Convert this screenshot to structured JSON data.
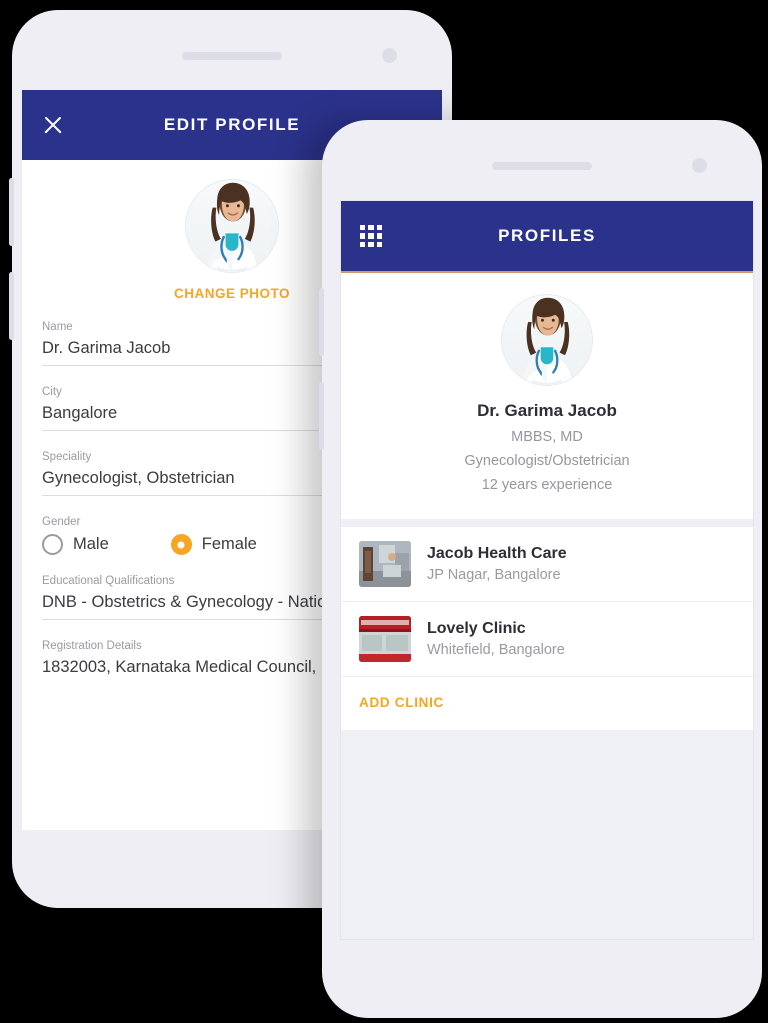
{
  "theme": {
    "primary": "#2b328b",
    "accent": "#f5a623",
    "page_background": "#000000",
    "phone_body": "#eeeef4",
    "screen_background": "#eff0f5",
    "rule_color": "#cc9a62"
  },
  "edit_profile": {
    "appbar": {
      "title": "EDIT PROFILE",
      "close_icon": "close-icon"
    },
    "avatar_alt": "doctor-portrait",
    "change_photo_label": "CHANGE PHOTO",
    "fields": [
      {
        "label": "Name",
        "value": "Dr. Garima Jacob"
      },
      {
        "label": "City",
        "value": "Bangalore"
      },
      {
        "label": "Speciality",
        "value": "Gynecologist, Obstetrician"
      }
    ],
    "gender": {
      "label": "Gender",
      "options": [
        {
          "label": "Male",
          "selected": false
        },
        {
          "label": "Female",
          "selected": true
        }
      ]
    },
    "qualifications": {
      "label": "Educational Qualifications",
      "value": "DNB - Obstetrics & Gynecology - Natio"
    },
    "registration": {
      "label": "Registration Details",
      "value": "1832003, Karnataka Medical Council,"
    }
  },
  "profiles": {
    "appbar": {
      "title": "PROFILES",
      "menu_icon": "grid-menu-icon"
    },
    "doctor": {
      "avatar_alt": "doctor-portrait",
      "name": "Dr. Garima Jacob",
      "degrees": "MBBS, MD",
      "speciality": "Gynecologist/Obstetrician",
      "experience": "12 years experience"
    },
    "clinics": [
      {
        "name": "Jacob Health Care",
        "address": "JP Nagar, Bangalore",
        "thumb": "clinic-interior-photo"
      },
      {
        "name": "Lovely Clinic",
        "address": "Whitefield, Bangalore",
        "thumb": "clinic-storefront-photo"
      }
    ],
    "add_clinic_label": "ADD CLINIC"
  }
}
